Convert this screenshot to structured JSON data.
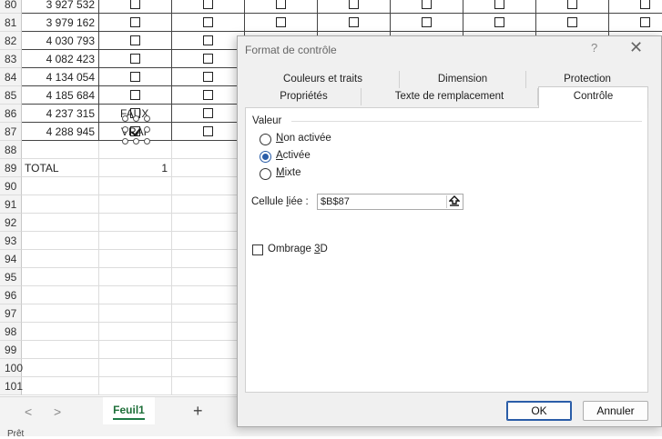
{
  "sheet": {
    "rows": [
      {
        "num": "80",
        "value": "3 927 532"
      },
      {
        "num": "81",
        "value": "3 979 162"
      },
      {
        "num": "82",
        "value": "4 030 793"
      },
      {
        "num": "83",
        "value": "4 082 423"
      },
      {
        "num": "84",
        "value": "4 134 054"
      },
      {
        "num": "85",
        "value": "4 185 684"
      },
      {
        "num": "86",
        "value": "4 237 315"
      },
      {
        "num": "87",
        "value": "4 288 945"
      },
      {
        "num": "88",
        "value": ""
      },
      {
        "num": "89",
        "value": "TOTAL"
      },
      {
        "num": "90",
        "value": ""
      },
      {
        "num": "91",
        "value": ""
      },
      {
        "num": "92",
        "value": ""
      },
      {
        "num": "93",
        "value": ""
      },
      {
        "num": "94",
        "value": ""
      },
      {
        "num": "95",
        "value": ""
      },
      {
        "num": "96",
        "value": ""
      },
      {
        "num": "97",
        "value": ""
      },
      {
        "num": "98",
        "value": ""
      },
      {
        "num": "99",
        "value": ""
      },
      {
        "num": "100",
        "value": ""
      },
      {
        "num": "101",
        "value": ""
      }
    ],
    "total_value": "1",
    "overlay_faux": "FAUX",
    "overlay_vrai": "VRAI"
  },
  "tabbar": {
    "prev_arrow": "<",
    "next_arrow": ">",
    "sheet_name": "Feuil1",
    "add_sheet": "+"
  },
  "statusbar": {
    "ready": "Prêt"
  },
  "dialog": {
    "title": "Format de contrôle",
    "help": "?",
    "close": "✕",
    "tabs_row1": [
      "Couleurs et traits",
      "Dimension",
      "Protection"
    ],
    "tabs_row2": [
      "Propriétés",
      "Texte de remplacement",
      "Contrôle"
    ],
    "active_tab": "Contrôle",
    "value_group": "Valeur",
    "radio_off": {
      "accel": "N",
      "rest": "on activée"
    },
    "radio_on": {
      "accel": "A",
      "rest": "ctivée"
    },
    "radio_mixed": {
      "accel": "M",
      "rest": "ixte"
    },
    "selected": "Activée",
    "linked_cell_label_pre": "Cellule ",
    "linked_cell_label_accel": "l",
    "linked_cell_label_post": "iée :",
    "linked_cell_value": "$B$87",
    "shade_label_pre": "Ombrage ",
    "shade_label_accel": "3",
    "shade_label_post": "D",
    "ok": "OK",
    "cancel": "Annuler"
  }
}
